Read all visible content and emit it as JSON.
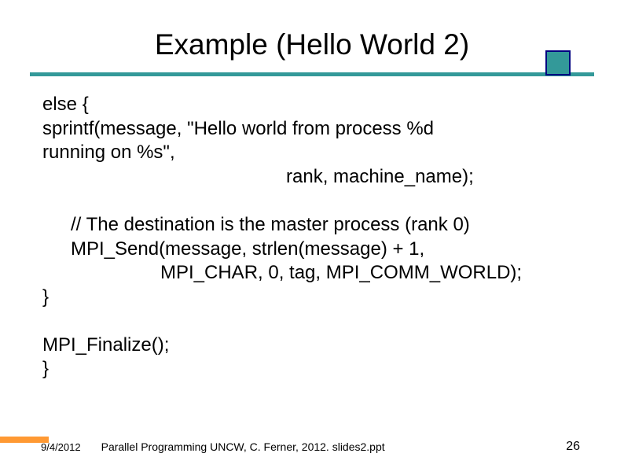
{
  "title": "Example (Hello World 2)",
  "code": {
    "line1": " else {",
    "line2": "   sprintf(message, \"Hello world from process %d",
    "line3": "running on %s\",",
    "line4": "rank, machine_name);",
    "line5": "// The destination is the master process (rank 0)",
    "line6": "MPI_Send(message, strlen(message) + 1,",
    "line7": "MPI_CHAR, 0, tag, MPI_COMM_WORLD);",
    "line8": "  }",
    "line9": "  MPI_Finalize();",
    "line10": "}"
  },
  "footer": {
    "date": "9/4/2012",
    "text": "Parallel Programming  UNCW, C. Ferner, 2012. slides2.ppt",
    "page": "26"
  }
}
